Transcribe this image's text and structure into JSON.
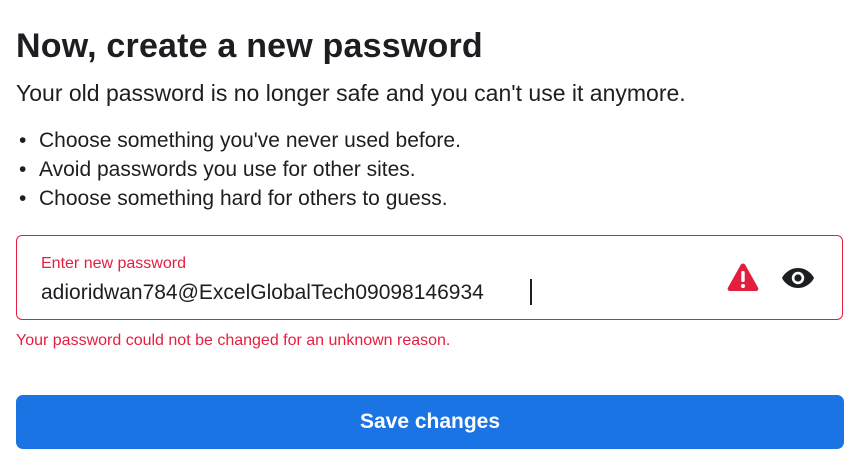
{
  "header": {
    "title": "Now, create a new password",
    "subtitle": "Your old password is no longer safe and you can't use it anymore."
  },
  "tips": [
    "Choose something you've never used before.",
    "Avoid passwords you use for other sites.",
    "Choose something hard for others to guess."
  ],
  "password_field": {
    "label": "Enter new password",
    "value": "adioridwan784@ExcelGlobalTech09098146934",
    "state": "error",
    "warning_icon": "warning-triangle-icon",
    "visibility_icon": "eye-icon"
  },
  "error_message": "Your password could not be changed for an unknown reason.",
  "actions": {
    "save_label": "Save changes"
  },
  "colors": {
    "error": "#e41e3f",
    "primary": "#1b74e4",
    "text": "#1c1e21"
  }
}
